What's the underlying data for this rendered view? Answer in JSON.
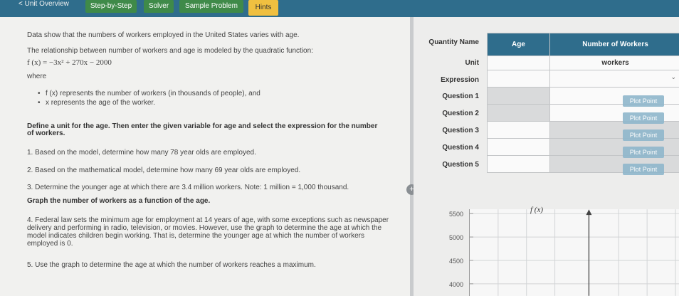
{
  "nav": {
    "back": "< Unit Overview",
    "tabs": [
      "Step-by-Step",
      "Solver",
      "Sample Problem",
      "Hints"
    ]
  },
  "problem": {
    "intro": "Data show that the numbers of workers employed in the United States varies with age.",
    "model_intro": "The relationship between number of workers and age is modeled by the quadratic function:",
    "function": "f (x) = −3x² + 270x − 2000",
    "where": "where",
    "bullet1": "f (x) represents the number of workers (in thousands of people), and",
    "bullet2": "x represents the age of the worker.",
    "instruction_line1": "Define a unit for the age. Then enter the given variable for age and select the expression for the number",
    "instruction_line2": "of workers.",
    "q1": "1. Based on the model, determine how many 78 year olds are employed.",
    "q2": "2. Based on the mathematical model, determine how many 69 year olds are employed.",
    "q3": "3. Determine the younger age at which there are 3.4 million workers. Note: 1 million = 1,000 thousand.",
    "graph_heading": "Graph the number of workers as a function of the age.",
    "q4": "4. Federal law sets the minimum age for employment at 14 years of age, with some exceptions such as newspaper delivery and performing in radio, television, or movies. However, use the graph to determine the age at which the model indicates children begin working. That is, determine the younger age at which the number of workers employed is 0.",
    "q5": "5. Use the graph to determine the age at which the number of workers reaches a maximum."
  },
  "table": {
    "row_labels": [
      "Quantity Name",
      "Unit",
      "Expression",
      "Question 1",
      "Question 2",
      "Question 3",
      "Question 4",
      "Question 5"
    ],
    "col_age": "Age",
    "col_workers": "Number of Workers",
    "workers_unit": "workers",
    "plot_button": "Plot Point"
  },
  "graph": {
    "y_ticks": [
      "5500",
      "5000",
      "4500",
      "4000"
    ],
    "func_label": "f (x)"
  },
  "colors": {
    "nav": "#2f6d8c",
    "tab_green": "#3f8a49",
    "hint": "#f0c040"
  }
}
